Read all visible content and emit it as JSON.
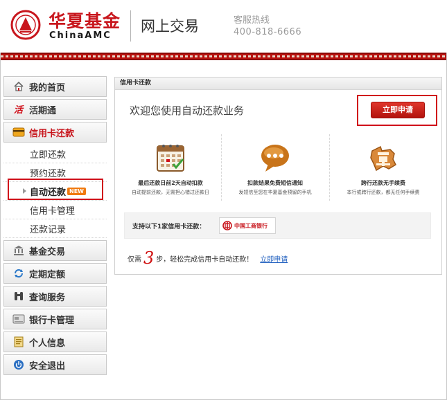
{
  "header": {
    "logo_cn": "华夏基金",
    "logo_en": "ChinaAMC",
    "title": "网上交易",
    "hotline_label": "客服热线",
    "hotline_number": "400-818-6666"
  },
  "colors": {
    "brand_red": "#c8161d",
    "highlight_red": "#d0101a",
    "link_blue": "#1f5fbf"
  },
  "sidebar": {
    "items": [
      {
        "label": "我的首页",
        "icon": "home-icon"
      },
      {
        "label": "活期通",
        "icon": "huo-icon"
      },
      {
        "label": "信用卡还款",
        "icon": "credit-card-icon",
        "active": true
      },
      {
        "label": "基金交易",
        "icon": "bank-building-icon"
      },
      {
        "label": "定期定额",
        "icon": "refresh-icon"
      },
      {
        "label": "查询服务",
        "icon": "binoculars-icon"
      },
      {
        "label": "银行卡管理",
        "icon": "bank-card-icon"
      },
      {
        "label": "个人信息",
        "icon": "document-icon"
      },
      {
        "label": "安全退出",
        "icon": "power-icon"
      }
    ],
    "sub_items": [
      {
        "label": "立即还款"
      },
      {
        "label": "预约还款"
      },
      {
        "label": "自动还款",
        "badge": "NEW",
        "current": true
      },
      {
        "label": "信用卡管理"
      },
      {
        "label": "还款记录"
      }
    ]
  },
  "main": {
    "panel_title": "信用卡还款",
    "welcome": "欢迎您使用自动还款业务",
    "apply_button": "立即申请",
    "features": [
      {
        "title": "最后还款日前2天自动扣款",
        "desc": "自动提前还款，无需担心错过还款日",
        "icon": "calendar-icon"
      },
      {
        "title": "扣款结果免费短信通知",
        "desc": "发短信至您在华夏基金预留的手机",
        "icon": "speech-bubble-icon"
      },
      {
        "title": "跨行还款无手续费",
        "desc": "本行或跨行还款，都无任何手续费",
        "icon": "free-stamp-icon"
      }
    ],
    "bank_label": "支持以下1家信用卡还款：",
    "bank_name": "中国工商银行",
    "steps_prefix": "仅需",
    "steps_number": "3",
    "steps_suffix": "步，轻松完成信用卡自动还款！",
    "steps_link": "立即申请"
  }
}
